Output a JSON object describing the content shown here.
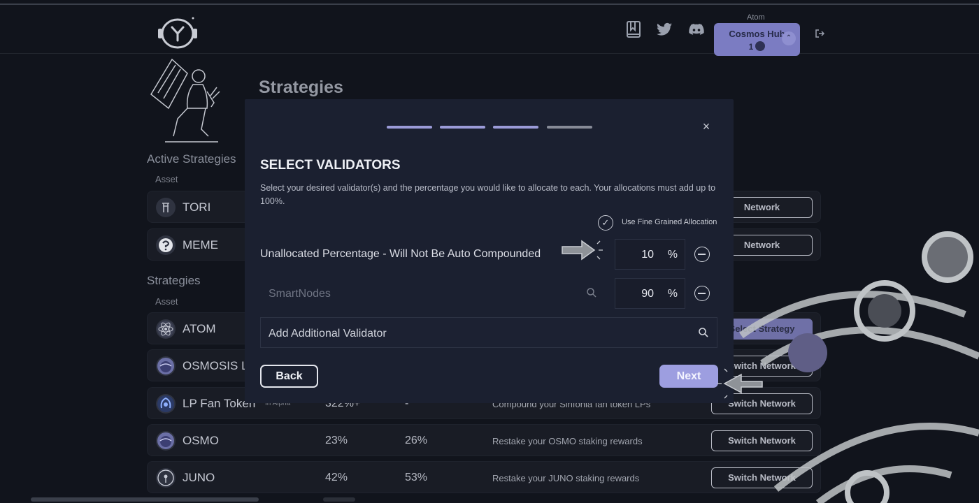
{
  "header": {
    "network_caption": "Atom",
    "network_name": "Cosmos Hub",
    "network_value": "1",
    "icons": [
      "book-icon",
      "twitter-icon",
      "discord-icon",
      "logout-icon"
    ]
  },
  "page": {
    "title": "Strategies",
    "active_section": "Active Strategies",
    "strategies_section": "Strategies",
    "asset_header": "Asset"
  },
  "active_strategies": [
    {
      "name": "TORI",
      "button": "Network"
    },
    {
      "name": "MEME",
      "button": "Network"
    }
  ],
  "strategies": [
    {
      "name": "ATOM",
      "apr": "",
      "apy": "",
      "desc": "",
      "button": "Select Strategy"
    },
    {
      "name": "OSMOSIS LI",
      "apr": "",
      "apy": "",
      "desc": "",
      "button": "Switch Network"
    },
    {
      "name": "LP Fan Token",
      "badge": "In Alpha",
      "apr": "322%+",
      "apy": "-",
      "desc": "Compound your Sinfonia fan token LPs",
      "button": "Switch Network"
    },
    {
      "name": "OSMO",
      "apr": "23%",
      "apy": "26%",
      "desc": "Restake your OSMO staking rewards",
      "button": "Switch Network"
    },
    {
      "name": "JUNO",
      "apr": "42%",
      "apy": "53%",
      "desc": "Restake your JUNO staking rewards",
      "button": "Switch Network"
    }
  ],
  "modal": {
    "steps_total": 4,
    "steps_active": 3,
    "title": "SELECT VALIDATORS",
    "description": "Select your desired validator(s) and the percentage you would like to allocate to each. Your allocations must add up to 100%.",
    "fine_grained_label": "Use Fine Grained Allocation",
    "fine_grained_checked": true,
    "unallocated_label": "Unallocated Percentage - Will Not Be Auto Compounded",
    "unallocated_value": "10",
    "validator_name": "SmartNodes",
    "validator_value": "90",
    "percent_sign": "%",
    "add_validator_label": "Add Additional Validator",
    "back_label": "Back",
    "next_label": "Next"
  },
  "colors": {
    "accent": "#9d9ee0",
    "modal_bg": "#1b2030",
    "page_bg": "#11141c"
  }
}
